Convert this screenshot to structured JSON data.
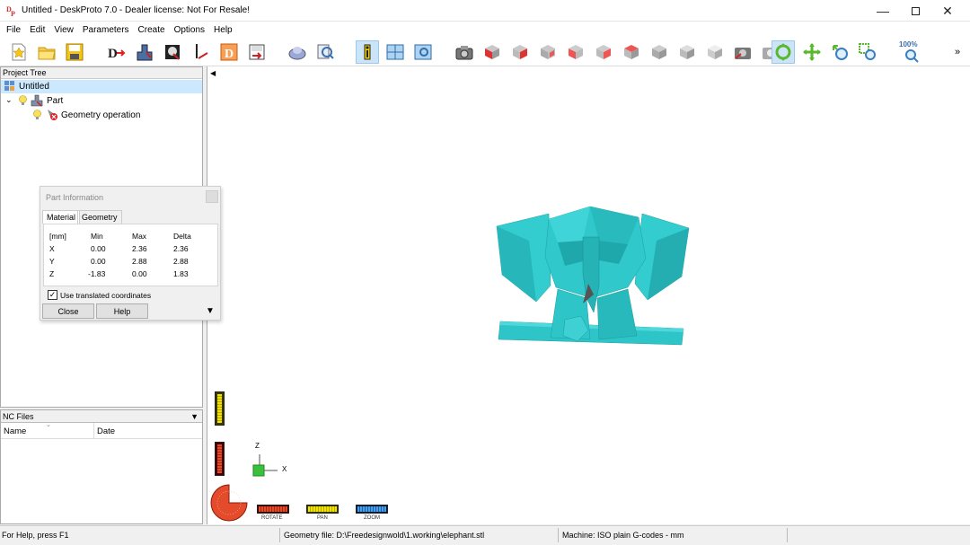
{
  "window": {
    "title": "Untitled - DeskProto 7.0 - Dealer license: Not For Resale!",
    "logo_text": "DP"
  },
  "menu": [
    "File",
    "Edit",
    "View",
    "Parameters",
    "Create",
    "Options",
    "Help"
  ],
  "toolbar": {
    "zoom_level": "100%",
    "icons": [
      "new-project-icon",
      "open-folder-icon",
      "save-icon",
      "import-geometry-icon",
      "part-icon",
      "vector-icon",
      "bitmap-icon",
      "export-dxf-icon",
      "export-icon",
      "simulation-icon",
      "search-icon",
      "info-icon",
      "split-view-icon",
      "preview-icon",
      "camera-icon",
      "view-front-cube-icon",
      "view-red-cube-icon",
      "view-back-cube-icon",
      "view-left-cube-icon",
      "view-right-cube-icon",
      "view-top-cube-icon",
      "view-bottom-cube-icon",
      "view-iso-cube-icon",
      "view-grey-cube-icon",
      "screenshot-icon",
      "render-icon",
      "rotate-mode-icon",
      "pan-mode-icon",
      "zoom-in-icon",
      "zoom-window-icon",
      "zoom-100-icon",
      "more-icon"
    ]
  },
  "project_tree": {
    "header": "Project Tree",
    "root": "Untitled",
    "part": "Part",
    "operation": "Geometry operation"
  },
  "part_info": {
    "title": "Part Information",
    "tabs": [
      "Material",
      "Geometry"
    ],
    "headers": [
      "[mm]",
      "Min",
      "Max",
      "Delta"
    ],
    "rows": [
      {
        "axis": "X",
        "min": "0.00",
        "max": "2.36",
        "delta": "2.36"
      },
      {
        "axis": "Y",
        "min": "0.00",
        "max": "2.88",
        "delta": "2.88"
      },
      {
        "axis": "Z",
        "min": "-1.83",
        "max": "0.00",
        "delta": "1.83"
      }
    ],
    "checkbox_label": "Use translated coordinates",
    "checkbox_checked": true,
    "close_label": "Close",
    "help_label": "Help"
  },
  "nc_files": {
    "header": "NC Files",
    "columns": [
      "Name",
      "Date"
    ]
  },
  "viewport": {
    "axis_z": "Z",
    "axis_x": "X",
    "controls": [
      "ROTATE",
      "PAN",
      "ZOOM"
    ],
    "model_color": "#2ec5c8"
  },
  "status": {
    "help": "For Help, press F1",
    "geometry_file": "Geometry file: D:\\Freedesignwold\\1.working\\elephant.stl",
    "machine": "Machine: ISO plain G-codes - mm"
  }
}
